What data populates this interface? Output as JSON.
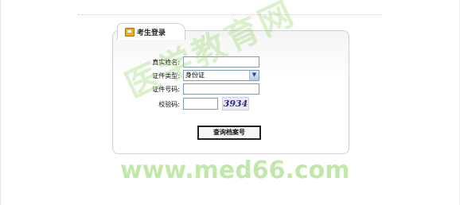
{
  "form": {
    "tab_title": "考生登录",
    "fields": [
      {
        "label": "真实姓名:",
        "value": ""
      },
      {
        "label": "证件类型:",
        "value": "身份证"
      },
      {
        "label": "证件号码:",
        "value": ""
      },
      {
        "label": "校验码:",
        "value": "",
        "captcha": "3934"
      }
    ],
    "submit_label": "查询档案号"
  },
  "watermark": {
    "text": "医学教育网",
    "url": "www.med66.com"
  },
  "icons": {
    "tab_icon": "login-folder-icon",
    "select_arrow": "chevron-down-icon"
  },
  "colors": {
    "input_border": "#7f9db9",
    "watermark": "#96d86e",
    "captcha_text": "#232d8f"
  }
}
